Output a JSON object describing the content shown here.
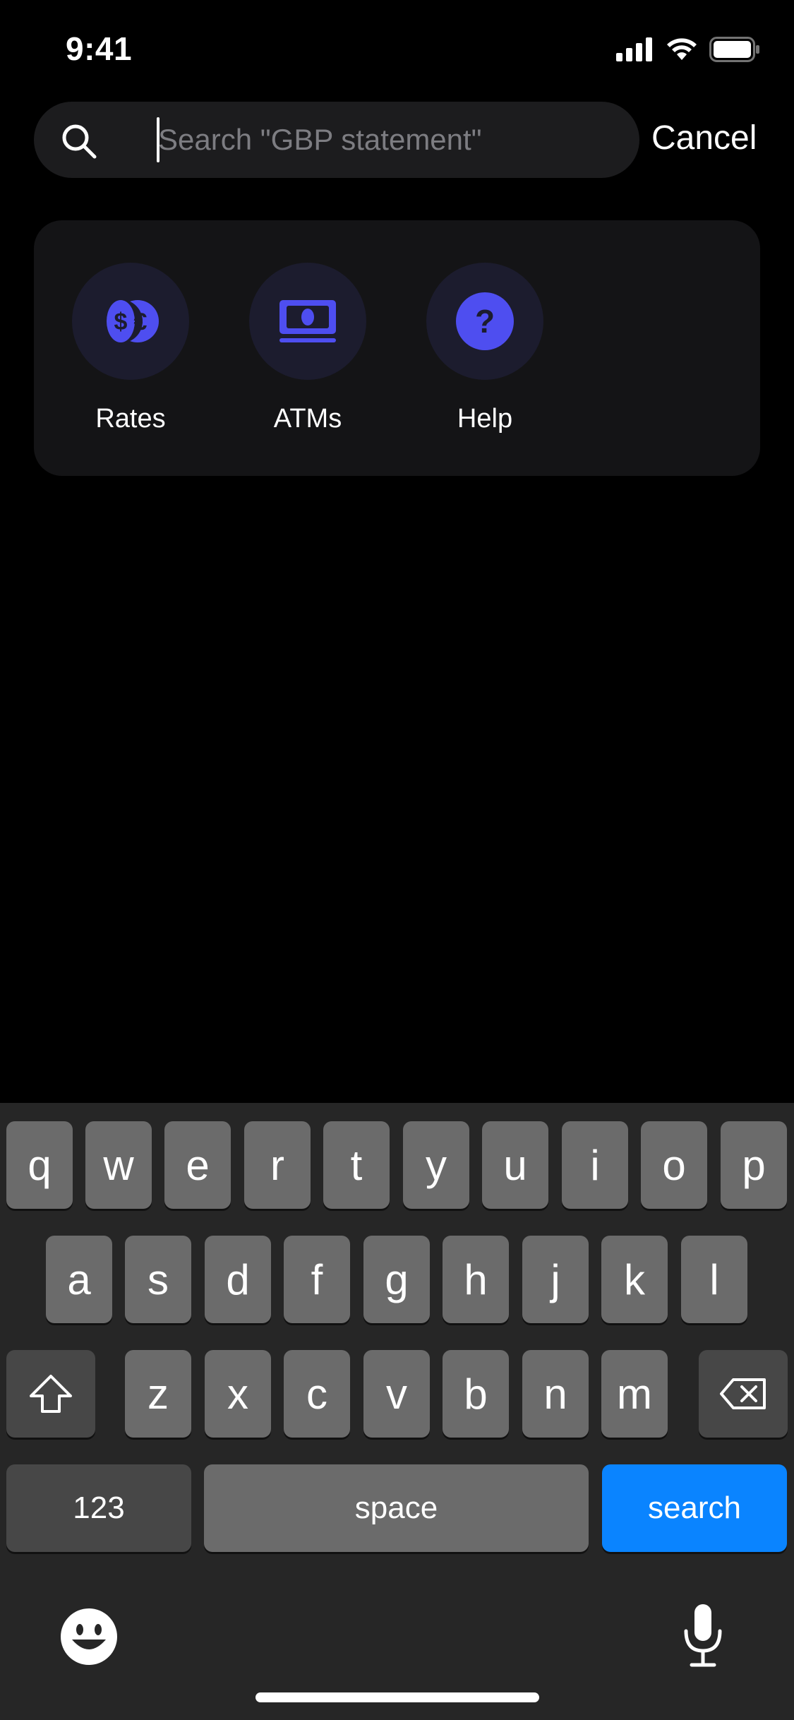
{
  "status_bar": {
    "time": "9:41"
  },
  "search": {
    "placeholder": "Search \"GBP statement\"",
    "value": "",
    "cancel_label": "Cancel"
  },
  "quick_actions": [
    {
      "label": "Rates",
      "icon": "currency-exchange-icon"
    },
    {
      "label": "ATMs",
      "icon": "cash-icon"
    },
    {
      "label": "Help",
      "icon": "question-icon"
    }
  ],
  "colors": {
    "accent": "#4e4ef0",
    "search_key": "#0a84ff",
    "card": "#141416"
  },
  "keyboard": {
    "row1": [
      "q",
      "w",
      "e",
      "r",
      "t",
      "y",
      "u",
      "i",
      "o",
      "p"
    ],
    "row2": [
      "a",
      "s",
      "d",
      "f",
      "g",
      "h",
      "j",
      "k",
      "l"
    ],
    "row3": [
      "z",
      "x",
      "c",
      "v",
      "b",
      "n",
      "m"
    ],
    "numbers_label": "123",
    "space_label": "space",
    "search_label": "search"
  }
}
